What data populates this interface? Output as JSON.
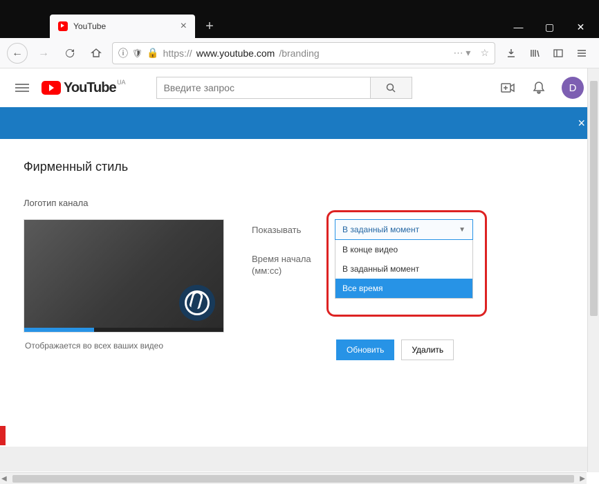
{
  "window": {
    "tab_title": "YouTube"
  },
  "url": {
    "protocol": "https://",
    "host": "www.youtube.com",
    "path": "/branding"
  },
  "yt": {
    "logo_text": "YouTube",
    "logo_region": "UA",
    "search_placeholder": "Введите запрос",
    "avatar_initial": "D"
  },
  "page": {
    "title": "Фирменный стиль",
    "section": "Логотип канала",
    "preview_caption": "Отображается во всех ваших видео"
  },
  "form": {
    "show_label": "Показывать",
    "start_label": "Время начала (мм:cc)",
    "dropdown_selected": "В заданный момент",
    "options": [
      "В конце видео",
      "В заданный момент",
      "Все время"
    ],
    "update_btn": "Обновить",
    "delete_btn": "Удалить"
  }
}
